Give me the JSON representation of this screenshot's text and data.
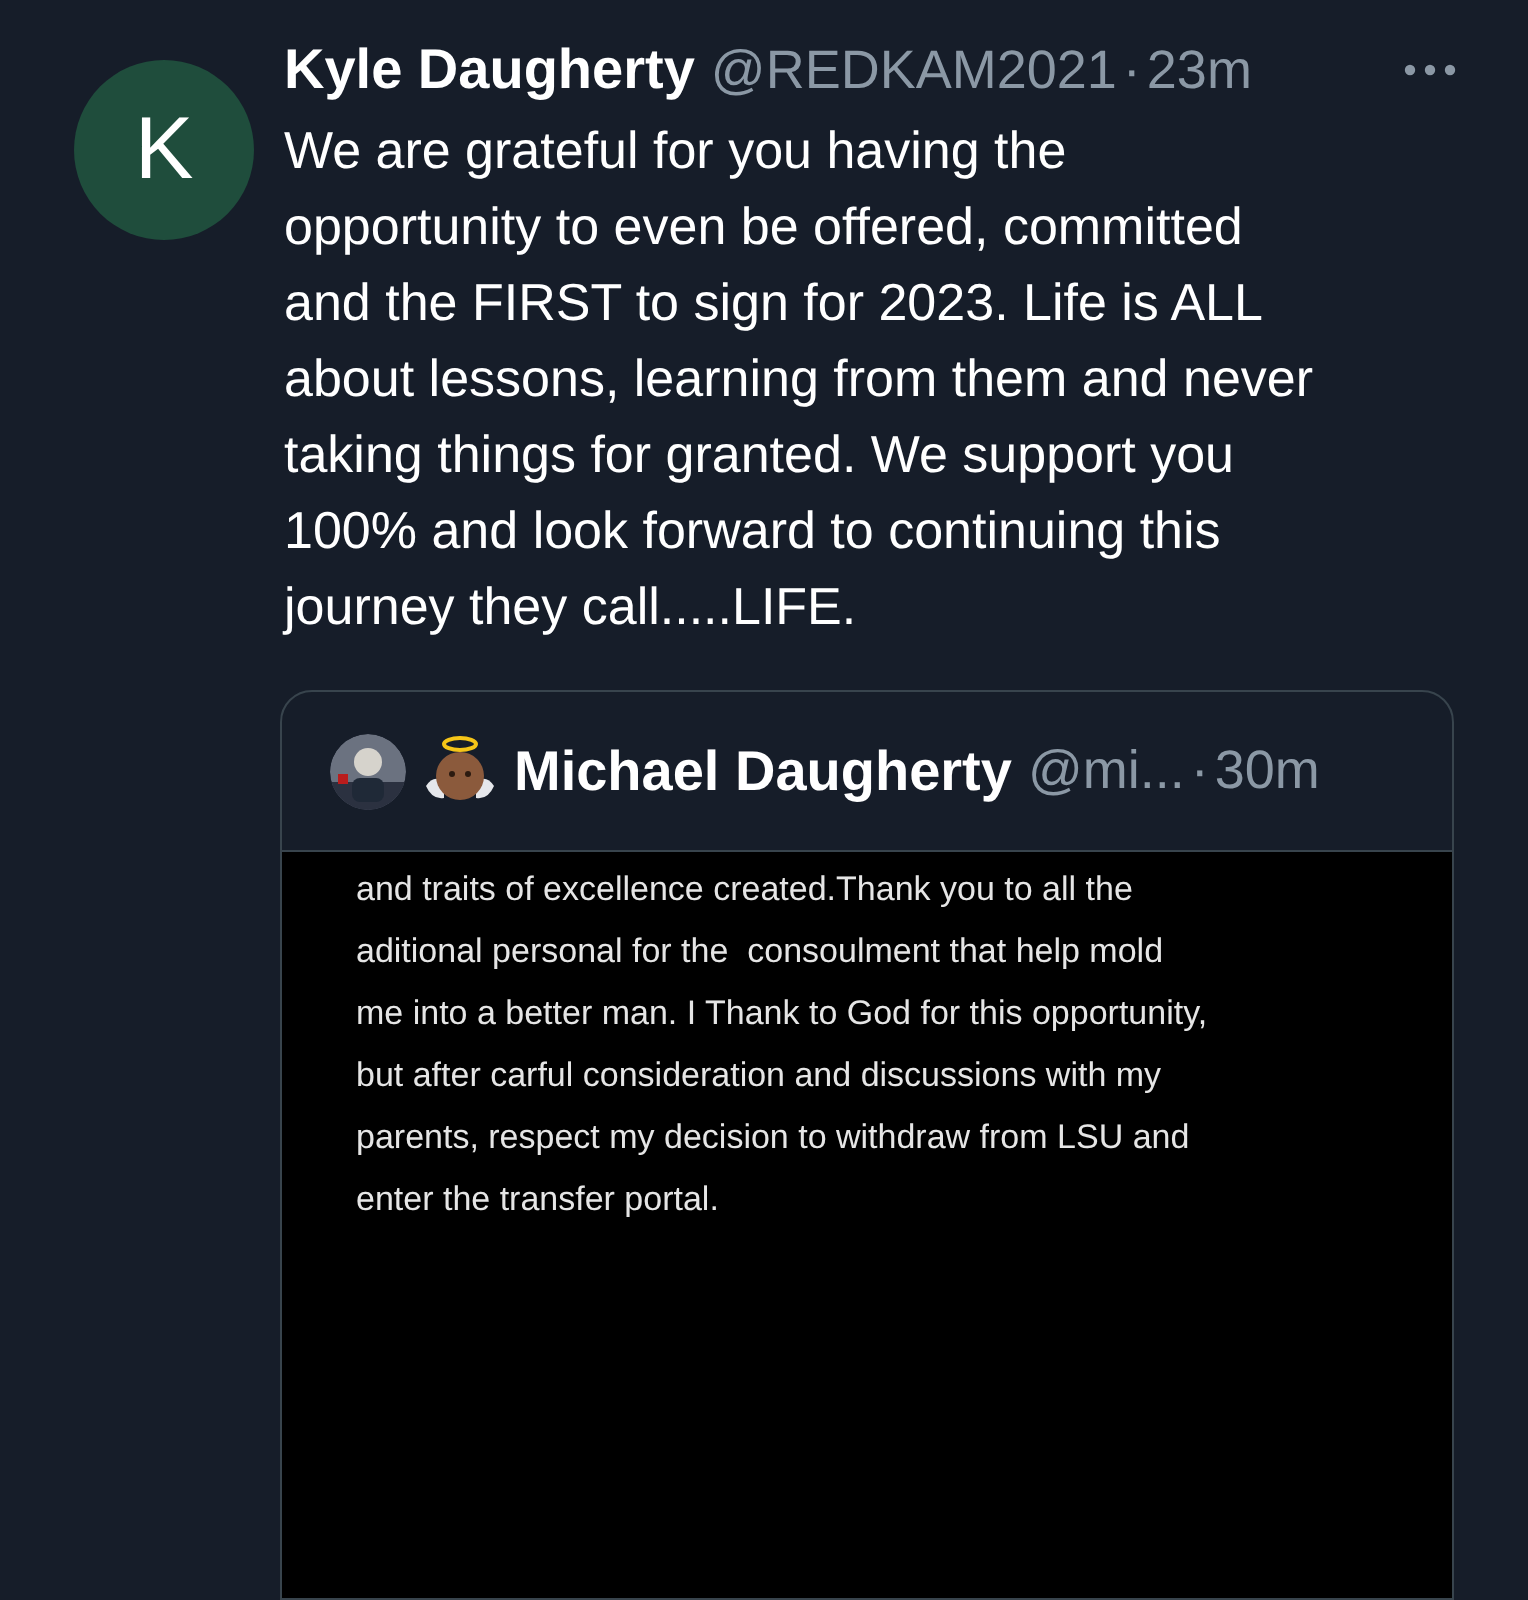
{
  "tweet": {
    "avatar_letter": "K",
    "author": "Kyle Daugherty",
    "handle": "@REDKAM2021",
    "separator": "·",
    "time": "23m",
    "text_lines": [
      "We are grateful for you having the",
      "opportunity to even be offered, committed",
      "and the FIRST to sign for 2023. Life is ALL",
      "about lessons, learning from them and never",
      "taking things for granted. We support you",
      "100% and look forward to continuing this",
      "journey they call.....LIFE."
    ]
  },
  "quoted": {
    "author": "Michael Daugherty",
    "handle": "@mi...",
    "separator": "·",
    "time": "30m",
    "image_lines": [
      "and traits of excellence created.Thank you to all the",
      "aditional personal for the  consoulment that help mold",
      "me into a better man. I Thank to God for this opportunity,",
      "but after carful consideration and discussions with my",
      "parents, respect my decision to withdraw from LSU and",
      "enter the transfer portal."
    ]
  }
}
